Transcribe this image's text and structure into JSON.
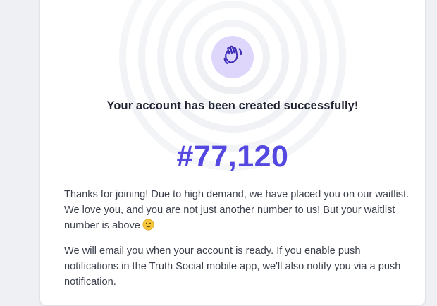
{
  "colors": {
    "accent": "#5448e0",
    "badge_bg": "#ded7fb",
    "text": "#3a3f4b",
    "heading": "#1f2331"
  },
  "hero": {
    "icon": "waving-hand-icon",
    "headline": "Your account has been created successfully!"
  },
  "waitlist": {
    "number": "#77,120"
  },
  "body": {
    "paragraph1": "Thanks for joining! Due to high demand, we have placed you on our waitlist. We love you, and you are not just another number to us! But your waitlist number is above",
    "paragraph1_emoji": "slightly-smiling-face-icon",
    "paragraph2": "We will email you when your account is ready. If you enable push notifications in the Truth Social mobile app, we'll also notify you via a push notification."
  }
}
